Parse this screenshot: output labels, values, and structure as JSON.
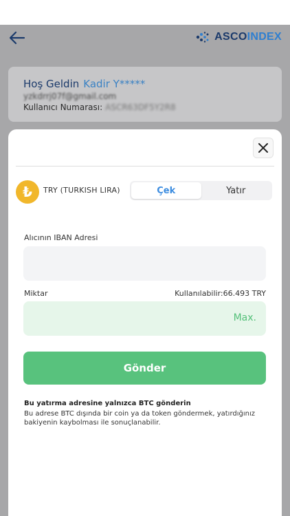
{
  "header": {
    "brand_name_part1": "ASCO",
    "brand_name_part2": "INDEX",
    "back_icon": "arrow-left-icon",
    "logo_icon": "ascoindex-logo-icon"
  },
  "welcome": {
    "greeting": "Hoş Geldin",
    "username": "Kadir Y*****",
    "email": "yzkdrrj07f@gmail.com",
    "user_number_label": "Kullanıcı Numarası:",
    "user_number_value": "ASCR63DF5Y2R8"
  },
  "modal": {
    "close_icon": "close-icon",
    "currency": {
      "symbol": "₺",
      "label": "TRY (TURKISH LIRA)",
      "icon": "turkish-lira-icon"
    },
    "tabs": [
      {
        "label": "Çek",
        "active": true
      },
      {
        "label": "Yatır",
        "active": false
      }
    ],
    "iban": {
      "label": "Alıcının IBAN Adresi",
      "value": "",
      "placeholder": ""
    },
    "amount": {
      "label": "Miktar",
      "available": "Kullanılabilir:66.493 TRY",
      "value": "",
      "max_label": "Max."
    },
    "send_label": "Gönder",
    "warning_title": "Bu yatırma adresine yalnızca BTC gönderin",
    "warning_text": "Bu adrese BTC dışında bir coin ya da token göndermek, yatırdığınız bakiyenin kaybolması ile sonuçlanabilir."
  },
  "colors": {
    "accent_blue": "#3d8de0",
    "brand_navy": "#1b3a6b",
    "success_green": "#58c27d",
    "coin_gold": "#f1b72b"
  }
}
